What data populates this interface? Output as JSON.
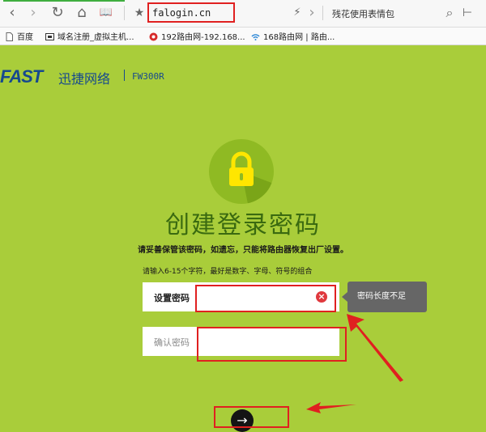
{
  "browser": {
    "url": "falogin.cn",
    "search_text": "残花使用表情包",
    "buttons": {
      "back": "‹",
      "forward": "›",
      "refresh": "↻",
      "home": "⌂",
      "reader": "📖",
      "star": "★",
      "flash": "⚡",
      "arrow": "›",
      "search": "⌕",
      "more": "⊢"
    }
  },
  "bookmarks": [
    {
      "label": "百度",
      "icon": "page-icon"
    },
    {
      "label": "域名注册_虚拟主机...",
      "icon": "domain-icon"
    },
    {
      "label": "192路由网-192.168...",
      "icon": "router-icon"
    },
    {
      "label": "168路由网 | 路由...",
      "icon": "wifi-icon"
    }
  ],
  "brand": {
    "logo": "FAST",
    "name": "迅捷网络",
    "model": "FW300R"
  },
  "page": {
    "title": "创建登录密码",
    "warning": "请妥善保管该密码，如遗忘，只能将路由器恢复出厂设置。",
    "hint": "请输入6-15个字符，最好是数字、字母、符号的组合"
  },
  "form": {
    "password_label": "设置密码",
    "password_value": "",
    "confirm_label": "确认密码",
    "confirm_value": "",
    "clear_glyph": "×",
    "tooltip": "密码长度不足"
  },
  "next_button": "→",
  "colors": {
    "background": "#a9cd3a",
    "annotation": "#e02020",
    "brand": "#16498e"
  }
}
